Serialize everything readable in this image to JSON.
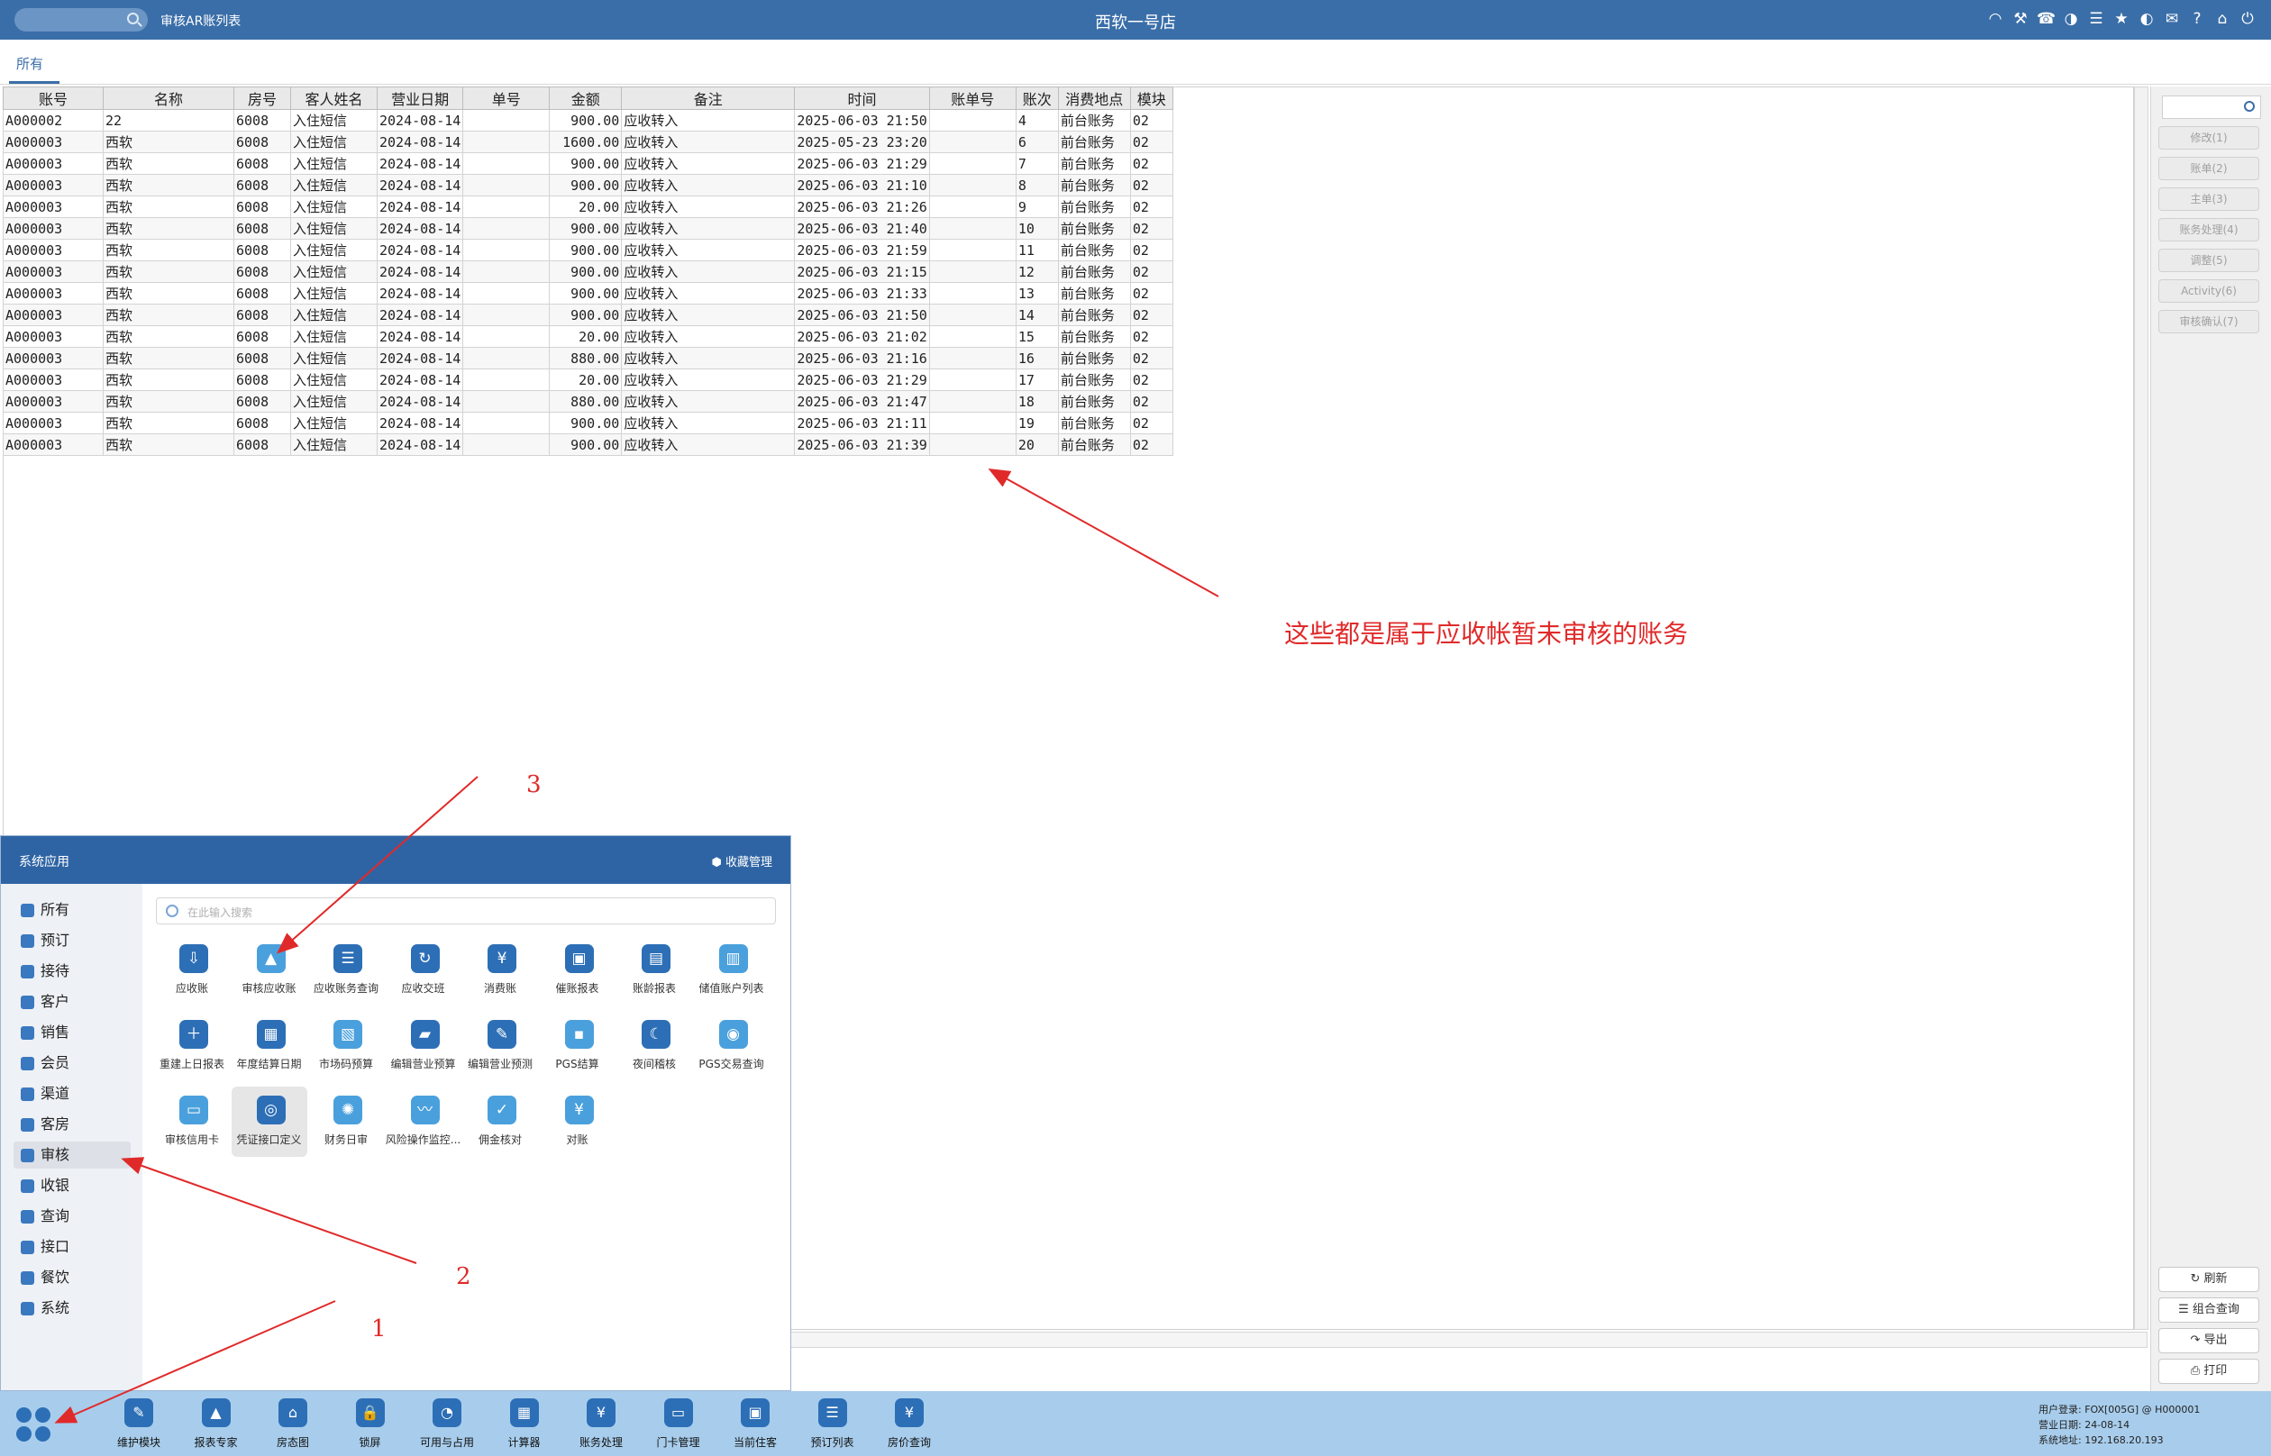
{
  "topbar": {
    "app_title": "审核AR账列表",
    "store_name": "西软一号店",
    "icons": [
      "wifi-icon",
      "tools-icon",
      "phone-icon",
      "palette-icon",
      "menu-icon",
      "star-icon",
      "contrast-icon",
      "mail-icon",
      "help-icon",
      "home-icon",
      "power-icon"
    ]
  },
  "tabs": {
    "all": "所有"
  },
  "table": {
    "columns": [
      "账号",
      "名称",
      "房号",
      "客人姓名",
      "营业日期",
      "单号",
      "金额",
      "备注",
      "时间",
      "账单号",
      "账次",
      "消费地点",
      "模块"
    ],
    "rows": [
      [
        "A000002",
        "22",
        "6008",
        "入住短信",
        "2024-08-14",
        "",
        "900.00",
        "应收转入",
        "2025-06-03 21:50",
        "",
        "4",
        "前台账务",
        "02"
      ],
      [
        "A000003",
        "西软",
        "6008",
        "入住短信",
        "2024-08-14",
        "",
        "1600.00",
        "应收转入",
        "2025-05-23 23:20",
        "",
        "6",
        "前台账务",
        "02"
      ],
      [
        "A000003",
        "西软",
        "6008",
        "入住短信",
        "2024-08-14",
        "",
        "900.00",
        "应收转入",
        "2025-06-03 21:29",
        "",
        "7",
        "前台账务",
        "02"
      ],
      [
        "A000003",
        "西软",
        "6008",
        "入住短信",
        "2024-08-14",
        "",
        "900.00",
        "应收转入",
        "2025-06-03 21:10",
        "",
        "8",
        "前台账务",
        "02"
      ],
      [
        "A000003",
        "西软",
        "6008",
        "入住短信",
        "2024-08-14",
        "",
        "20.00",
        "应收转入",
        "2025-06-03 21:26",
        "",
        "9",
        "前台账务",
        "02"
      ],
      [
        "A000003",
        "西软",
        "6008",
        "入住短信",
        "2024-08-14",
        "",
        "900.00",
        "应收转入",
        "2025-06-03 21:40",
        "",
        "10",
        "前台账务",
        "02"
      ],
      [
        "A000003",
        "西软",
        "6008",
        "入住短信",
        "2024-08-14",
        "",
        "900.00",
        "应收转入",
        "2025-06-03 21:59",
        "",
        "11",
        "前台账务",
        "02"
      ],
      [
        "A000003",
        "西软",
        "6008",
        "入住短信",
        "2024-08-14",
        "",
        "900.00",
        "应收转入",
        "2025-06-03 21:15",
        "",
        "12",
        "前台账务",
        "02"
      ],
      [
        "A000003",
        "西软",
        "6008",
        "入住短信",
        "2024-08-14",
        "",
        "900.00",
        "应收转入",
        "2025-06-03 21:33",
        "",
        "13",
        "前台账务",
        "02"
      ],
      [
        "A000003",
        "西软",
        "6008",
        "入住短信",
        "2024-08-14",
        "",
        "900.00",
        "应收转入",
        "2025-06-03 21:50",
        "",
        "14",
        "前台账务",
        "02"
      ],
      [
        "A000003",
        "西软",
        "6008",
        "入住短信",
        "2024-08-14",
        "",
        "20.00",
        "应收转入",
        "2025-06-03 21:02",
        "",
        "15",
        "前台账务",
        "02"
      ],
      [
        "A000003",
        "西软",
        "6008",
        "入住短信",
        "2024-08-14",
        "",
        "880.00",
        "应收转入",
        "2025-06-03 21:16",
        "",
        "16",
        "前台账务",
        "02"
      ],
      [
        "A000003",
        "西软",
        "6008",
        "入住短信",
        "2024-08-14",
        "",
        "20.00",
        "应收转入",
        "2025-06-03 21:29",
        "",
        "17",
        "前台账务",
        "02"
      ],
      [
        "A000003",
        "西软",
        "6008",
        "入住短信",
        "2024-08-14",
        "",
        "880.00",
        "应收转入",
        "2025-06-03 21:47",
        "",
        "18",
        "前台账务",
        "02"
      ],
      [
        "A000003",
        "西软",
        "6008",
        "入住短信",
        "2024-08-14",
        "",
        "900.00",
        "应收转入",
        "2025-06-03 21:11",
        "",
        "19",
        "前台账务",
        "02"
      ],
      [
        "A000003",
        "西软",
        "6008",
        "入住短信",
        "2024-08-14",
        "",
        "900.00",
        "应收转入",
        "2025-06-03 21:39",
        "",
        "20",
        "前台账务",
        "02"
      ]
    ]
  },
  "right_panel": {
    "buttons": [
      "修改(1)",
      "账单(2)",
      "主单(3)",
      "账务处理(4)",
      "调整(5)",
      "Activity(6)",
      "审核确认(7)"
    ],
    "bottom_buttons": [
      "刷新",
      "组合查询",
      "导出",
      "打印"
    ]
  },
  "menu": {
    "title": "系统应用",
    "fav": "收藏管理",
    "search_placeholder": "在此输入搜索",
    "categories": [
      "所有",
      "预订",
      "接待",
      "客户",
      "销售",
      "会员",
      "渠道",
      "客房",
      "审核",
      "收银",
      "查询",
      "接口",
      "餐饮",
      "系统"
    ],
    "active_category": "审核",
    "apps": [
      "应收账",
      "审核应收账",
      "应收账务查询",
      "应收交班",
      "消费账",
      "催账报表",
      "账龄报表",
      "储值账户列表",
      "重建上日报表",
      "年度结算日期",
      "市场码预算",
      "编辑营业预算",
      "编辑营业预测",
      "PGS结算",
      "夜间稽核",
      "PGS交易查询",
      "审核信用卡",
      "凭证接口定义",
      "财务日审",
      "风险操作监控...",
      "佣金核对",
      "对账"
    ]
  },
  "taskbar": {
    "items": [
      "维护模块",
      "报表专家",
      "房态图",
      "锁屏",
      "可用与占用",
      "计算器",
      "账务处理",
      "门卡管理",
      "当前住客",
      "预订列表",
      "房价查询"
    ],
    "sysinfo": [
      "用户登录:  FOX[005G] @ H000001",
      "营业日期:  24-08-14",
      "系统地址:  192.168.20.193"
    ]
  },
  "annotations": {
    "note": "这些都是属于应收帐暂未审核的账务",
    "step1": "1",
    "step2": "2",
    "step3": "3"
  }
}
